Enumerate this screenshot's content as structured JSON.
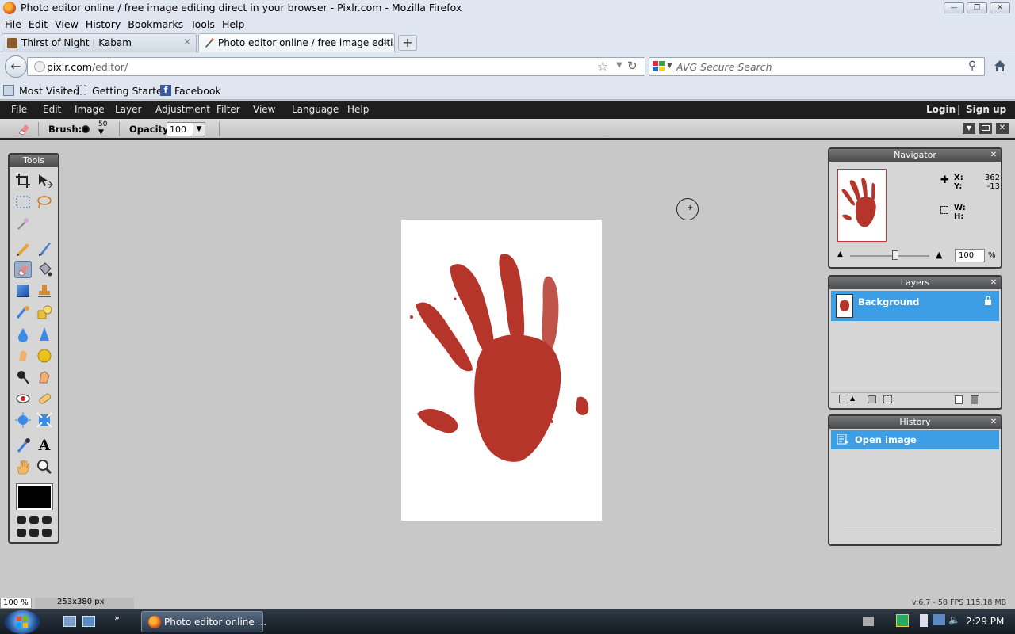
{
  "window": {
    "title": "Photo editor online / free image editing direct in your browser - Pixlr.com - Mozilla Firefox"
  },
  "browser_menu": [
    "File",
    "Edit",
    "View",
    "History",
    "Bookmarks",
    "Tools",
    "Help"
  ],
  "tabs": [
    {
      "label": "Thirst of Night | Kabam",
      "active": false
    },
    {
      "label": "Photo editor online / free image editi...",
      "active": true
    }
  ],
  "address": {
    "host": "pixlr.com",
    "path": "/editor/"
  },
  "search": {
    "placeholder": "AVG Secure Search"
  },
  "bookmarks": [
    "Most Visited",
    "Getting Started",
    "Facebook"
  ],
  "pixlr_menu": [
    "File",
    "Edit",
    "Image",
    "Layer",
    "Adjustment",
    "Filter",
    "View",
    "Language",
    "Help"
  ],
  "account": {
    "login": "Login",
    "separator": "|",
    "signup": "Sign up"
  },
  "options": {
    "brush_label": "Brush:",
    "brush_size": "50",
    "opacity_label": "Opacity:",
    "opacity_value": "100"
  },
  "tools_panel": {
    "title": "Tools"
  },
  "navigator": {
    "title": "Navigator",
    "x_label": "X:",
    "x_value": "362",
    "y_label": "Y:",
    "y_value": "-13",
    "w_label": "W:",
    "h_label": "H:",
    "zoom_value": "100",
    "zoom_unit": "%"
  },
  "layers": {
    "title": "Layers",
    "items": [
      {
        "name": "Background",
        "locked": true
      }
    ]
  },
  "history": {
    "title": "History",
    "items": [
      "Open image"
    ]
  },
  "status": {
    "zoom": "100 %",
    "size": "253x380 px",
    "version": "v:6.7 - 58 FPS 115.18 MB"
  },
  "taskbar": {
    "app_label": "Photo editor online ...",
    "clock": "2:29 PM"
  },
  "colors": {
    "accent": "#3d9ee6",
    "pixlr_bar": "#1e1e1e",
    "panel": "#d6d6d6",
    "handprint": "#b5352a"
  }
}
